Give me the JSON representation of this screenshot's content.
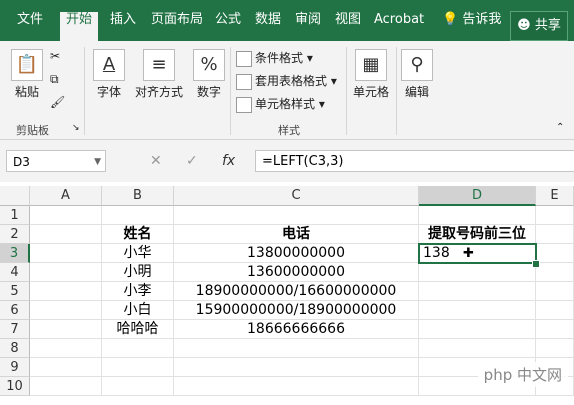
{
  "tabs": [
    "文件",
    "开始",
    "插入",
    "页面布局",
    "公式",
    "数据",
    "审阅",
    "视图",
    "Acrobat",
    "告诉我"
  ],
  "share_label": "共享",
  "ribbon": {
    "paste": "粘贴",
    "clipboard_group": "剪贴板",
    "font": "字体",
    "alignment": "对齐方式",
    "number": "数字",
    "number_symbol": "%",
    "conditional_format": "条件格式",
    "table_format": "套用表格格式",
    "cell_style": "单元格样式",
    "style_group": "样式",
    "cells": "单元格",
    "editing": "编辑"
  },
  "formula_bar": {
    "name_box": "D3",
    "formula": "=LEFT(C3,3)",
    "fx": "fx"
  },
  "columns": [
    "A",
    "B",
    "C",
    "D",
    "E"
  ],
  "rows": [
    "1",
    "2",
    "3",
    "4",
    "5",
    "6",
    "7",
    "8",
    "9",
    "10"
  ],
  "cells": {
    "B2": "姓名",
    "C2": "电话",
    "D2": "提取号码前三位",
    "B3": "小华",
    "C3": "13800000000",
    "D3": "138",
    "B4": "小明",
    "C4": "13600000000",
    "B5": "小李",
    "C5": "18900000000/16600000000",
    "B6": "小白",
    "C6": "15900000000/18900000000",
    "B7": "哈哈哈",
    "C7": "18666666666"
  },
  "watermark": "php 中文网",
  "colors": {
    "accent": "#217346"
  }
}
